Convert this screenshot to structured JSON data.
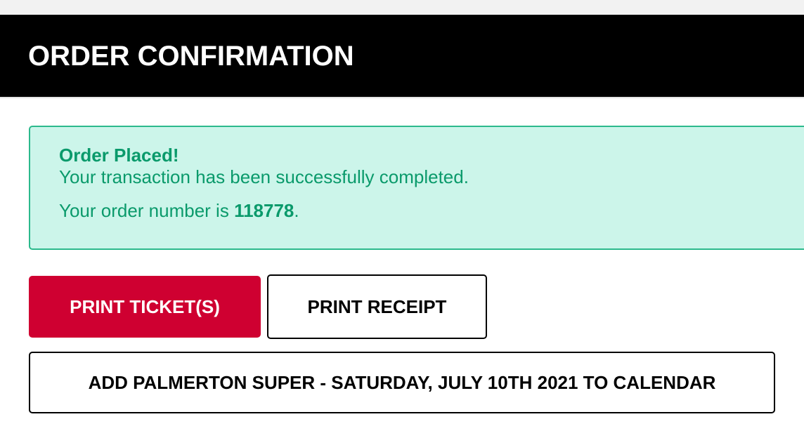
{
  "header": {
    "title": "ORDER CONFIRMATION"
  },
  "alert": {
    "heading": "Order Placed!",
    "message": "Your transaction has been successfully completed.",
    "order_prefix": "Your order number is ",
    "order_number": "118778",
    "order_suffix": "."
  },
  "actions": {
    "print_tickets_label": "PRINT TICKET(S)",
    "print_receipt_label": "PRINT RECEIPT",
    "add_calendar_label": "ADD PALMERTON SUPER - SATURDAY, JULY 10TH 2021 TO CALENDAR"
  },
  "colors": {
    "header_bg": "#000000",
    "alert_bg": "#ccf5ea",
    "alert_border": "#2bb98c",
    "alert_text": "#0a9a6b",
    "primary_button": "#cf0031"
  }
}
